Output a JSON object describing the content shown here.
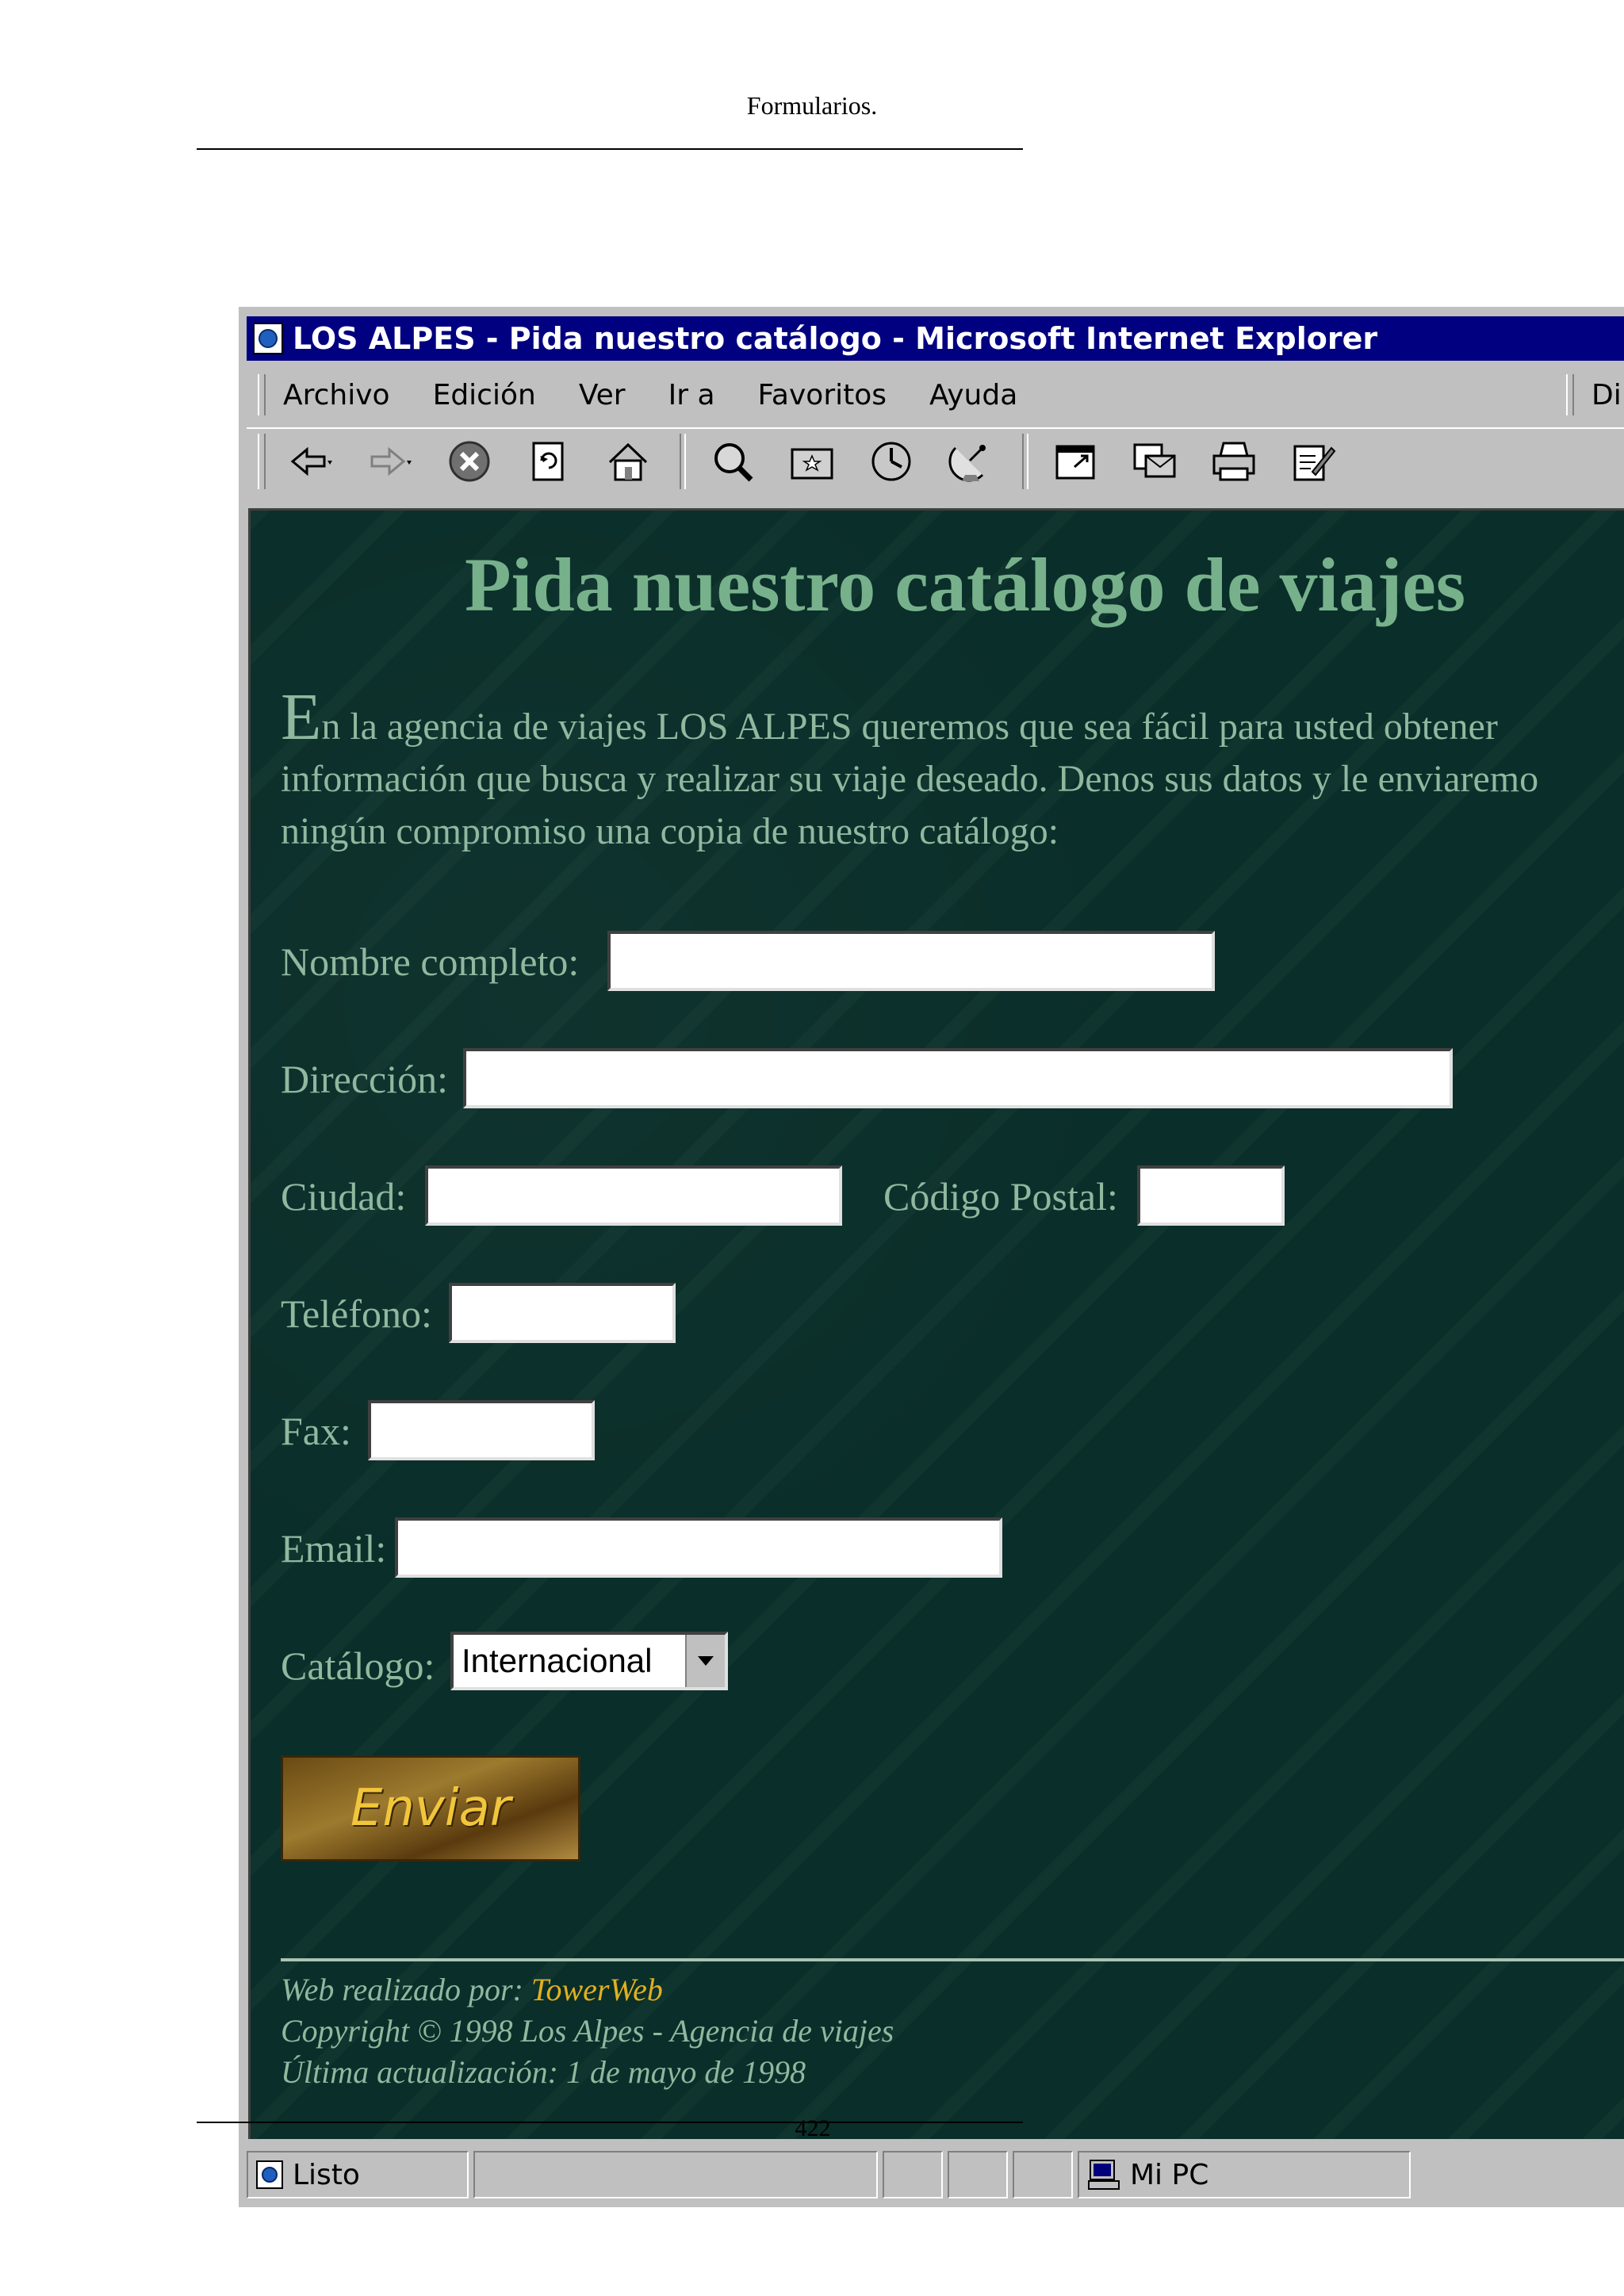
{
  "document": {
    "header": "Formularios.",
    "page_number": "422"
  },
  "window": {
    "title": "LOS ALPES - Pida nuestro catálogo - Microsoft Internet Explorer",
    "menu": [
      "Archivo",
      "Edición",
      "Ver",
      "Ir a",
      "Favoritos",
      "Ayuda"
    ],
    "address_label": "Dire",
    "toolbar_icons": [
      "back-icon",
      "forward-icon",
      "stop-icon",
      "refresh-icon",
      "home-icon",
      "search-icon",
      "favorites-icon",
      "history-icon",
      "channels-icon",
      "fullscreen-icon",
      "mail-icon",
      "print-icon",
      "edit-icon"
    ]
  },
  "page": {
    "title": "Pida nuestro catálogo de viajes",
    "intro_dropcap": "E",
    "intro_line1": "n la agencia de viajes LOS ALPES queremos que sea fácil para usted obtener",
    "intro_line2": "información que busca y realizar su viaje deseado. Denos sus datos y le enviaremo",
    "intro_line3": "ningún compromiso una copia de nuestro catálogo:",
    "form": {
      "nombre_label": "Nombre completo:",
      "direccion_label": "Dirección:",
      "ciudad_label": "Ciudad:",
      "codigo_postal_label": "Código Postal:",
      "telefono_label": "Teléfono:",
      "fax_label": "Fax:",
      "email_label": "Email:",
      "catalogo_label": "Catálogo:",
      "catalogo_value": "Internacional",
      "submit_label": "Enviar"
    },
    "footer": {
      "made_by_prefix": "Web realizado por: ",
      "made_by_link": "TowerWeb",
      "copyright": "Copyright © 1998 Los Alpes - Agencia de viajes",
      "updated": "Última actualización: 1 de mayo de 1998"
    }
  },
  "statusbar": {
    "status": "Listo",
    "zone": "Mi PC"
  },
  "colors": {
    "page_background": "#0a2e29",
    "title_green": "#77b18c",
    "text_green": "#8fb89f",
    "link_gold": "#e0b020",
    "titlebar": "#000080"
  }
}
